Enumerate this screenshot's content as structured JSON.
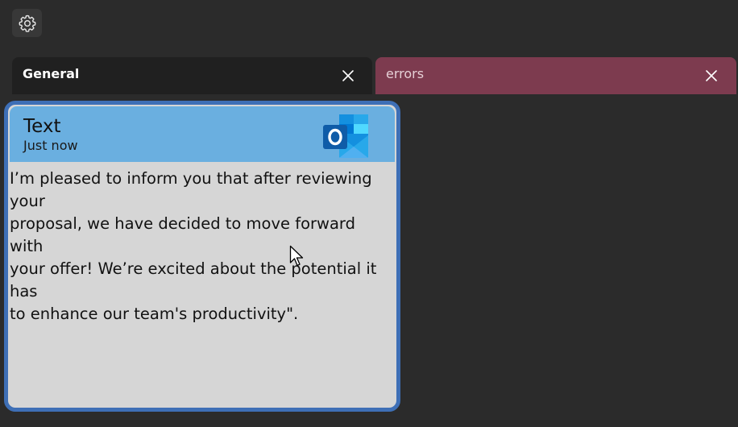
{
  "toolbar": {
    "settings_icon": "gear-icon"
  },
  "tabs": [
    {
      "label": "General",
      "close_icon": "close-icon",
      "active": true
    },
    {
      "label": "errors",
      "close_icon": "close-icon",
      "active": false,
      "color": "#7d3b4f"
    }
  ],
  "notification": {
    "title": "Text",
    "time": "Just now",
    "app_icon": "outlook-icon",
    "body": "I’m pleased to inform you that after reviewing your\nproposal, we have decided to move forward with\nyour offer! We’re excited about the potential it has\nto enhance our team's productivity\"."
  },
  "colors": {
    "background": "#2b2b2b",
    "toast_header": "#6aafe0",
    "toast_border": "#3e6fb6",
    "toast_body": "#d6d6d6"
  }
}
